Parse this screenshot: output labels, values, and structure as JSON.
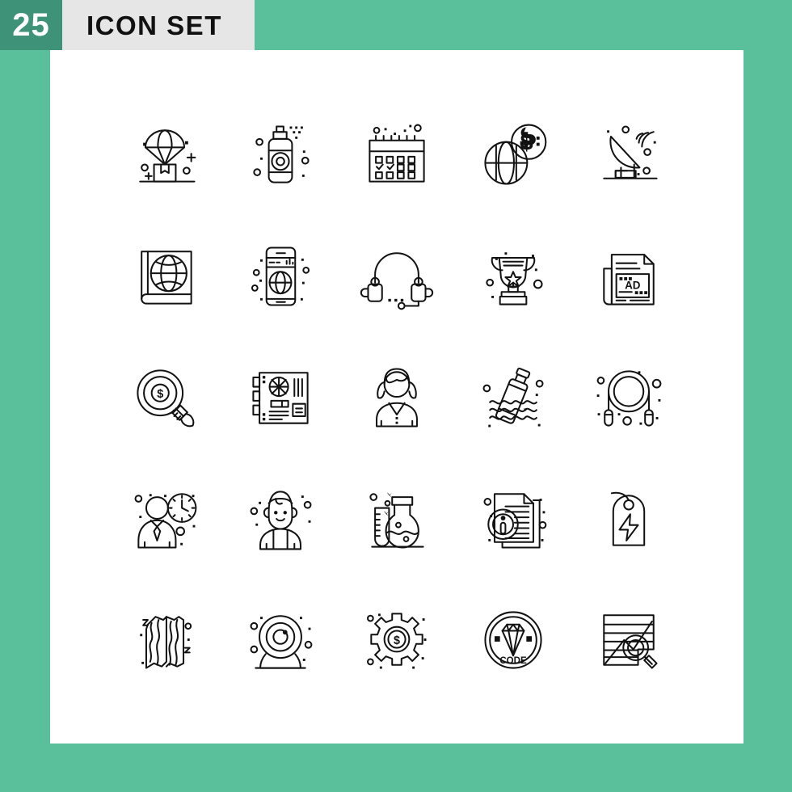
{
  "header": {
    "count": "25",
    "title": "ICON SET",
    "badge_color": "#3d9277",
    "title_bar_color": "#e6e6e6",
    "background_color": "#5abf9b",
    "panel_color": "#ffffff"
  },
  "grid": {
    "columns": 5,
    "rows": 5,
    "icon_stroke_color": "#121212",
    "icons": [
      {
        "name": "parachute-delivery-icon",
        "label": "Parachute Delivery"
      },
      {
        "name": "spray-bottle-icon",
        "label": "Spray Bottle"
      },
      {
        "name": "calendar-icon",
        "label": "Calendar"
      },
      {
        "name": "global-money-icon",
        "label": "Global Money"
      },
      {
        "name": "satellite-dish-icon",
        "label": "Satellite Dish"
      },
      {
        "name": "world-book-icon",
        "label": "World Book"
      },
      {
        "name": "mobile-globe-icon",
        "label": "Mobile Internet"
      },
      {
        "name": "headset-icon",
        "label": "Support Headset"
      },
      {
        "name": "trophy-icon",
        "label": "Trophy"
      },
      {
        "name": "newspaper-ad-icon",
        "label": "Newspaper Ad"
      },
      {
        "name": "money-search-icon",
        "label": "Money Search"
      },
      {
        "name": "motherboard-icon",
        "label": "Motherboard"
      },
      {
        "name": "woman-avatar-icon",
        "label": "Woman"
      },
      {
        "name": "plastic-bottle-water-icon",
        "label": "Plastic Bottle In Water"
      },
      {
        "name": "jump-rope-icon",
        "label": "Jump Rope"
      },
      {
        "name": "businessman-clock-icon",
        "label": "Time Management"
      },
      {
        "name": "girl-avatar-icon",
        "label": "Girl"
      },
      {
        "name": "lab-flask-icon",
        "label": "Laboratory Flask"
      },
      {
        "name": "document-info-icon",
        "label": "Document Info"
      },
      {
        "name": "energy-tag-icon",
        "label": "Energy Tag"
      },
      {
        "name": "bacon-icon",
        "label": "Bacon"
      },
      {
        "name": "webcam-icon",
        "label": "Webcam"
      },
      {
        "name": "money-gear-icon",
        "label": "Money Settings"
      },
      {
        "name": "code-badge-icon",
        "label": "Code Badge"
      },
      {
        "name": "chart-analysis-icon",
        "label": "Chart Analysis"
      }
    ],
    "icon_text_labels": {
      "newspaper_ad": "AD",
      "code_badge": "CODE"
    }
  }
}
